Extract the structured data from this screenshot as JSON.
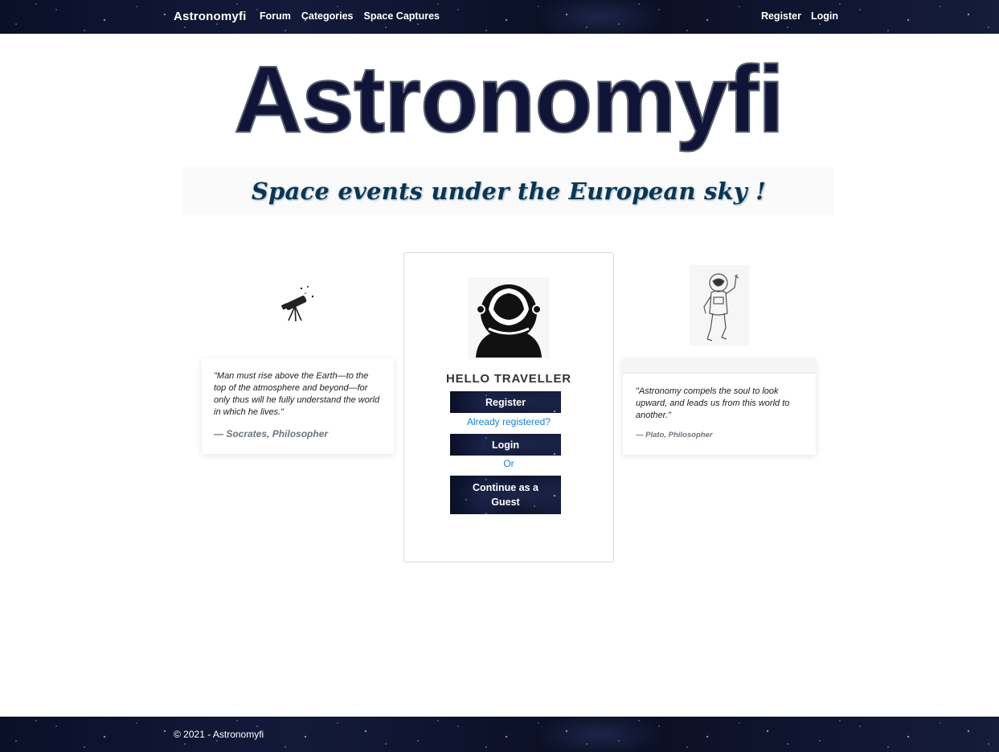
{
  "navbar": {
    "brand": "Astronomyfi",
    "links": [
      "Forum",
      "Categories",
      "Space Captures"
    ],
    "auth_links": [
      "Register",
      "Login"
    ]
  },
  "logo": {
    "text": "Astronomyfi"
  },
  "tagline": "Space events under the European sky !",
  "left_quote": {
    "text": "\"Man must rise above the Earth—to the top of the atmosphere and beyond—for only thus will he fully understand the world in which he lives.\"",
    "author": "— Socrates, Philosopher"
  },
  "center": {
    "greeting": "HELLO TRAVELLER",
    "register_label": "Register",
    "already_registered": "Already registered?",
    "login_label": "Login",
    "or_label": "Or",
    "guest_label": "Continue as a Guest"
  },
  "right_quote": {
    "text": "\"Astronomy compels the soul to look upward, and leads us from this world to another.\"",
    "author": "— Plato, Philosopher"
  },
  "footer": {
    "text": "© 2021 - Astronomyfi"
  },
  "colors": {
    "nav_bg": "#0a0f24",
    "tagline": "#0d3552",
    "link": "#1a7fd4",
    "muted": "#6c757d"
  },
  "icons": [
    "telescope-icon",
    "astronaut-helmet-icon",
    "astronaut-icon"
  ]
}
